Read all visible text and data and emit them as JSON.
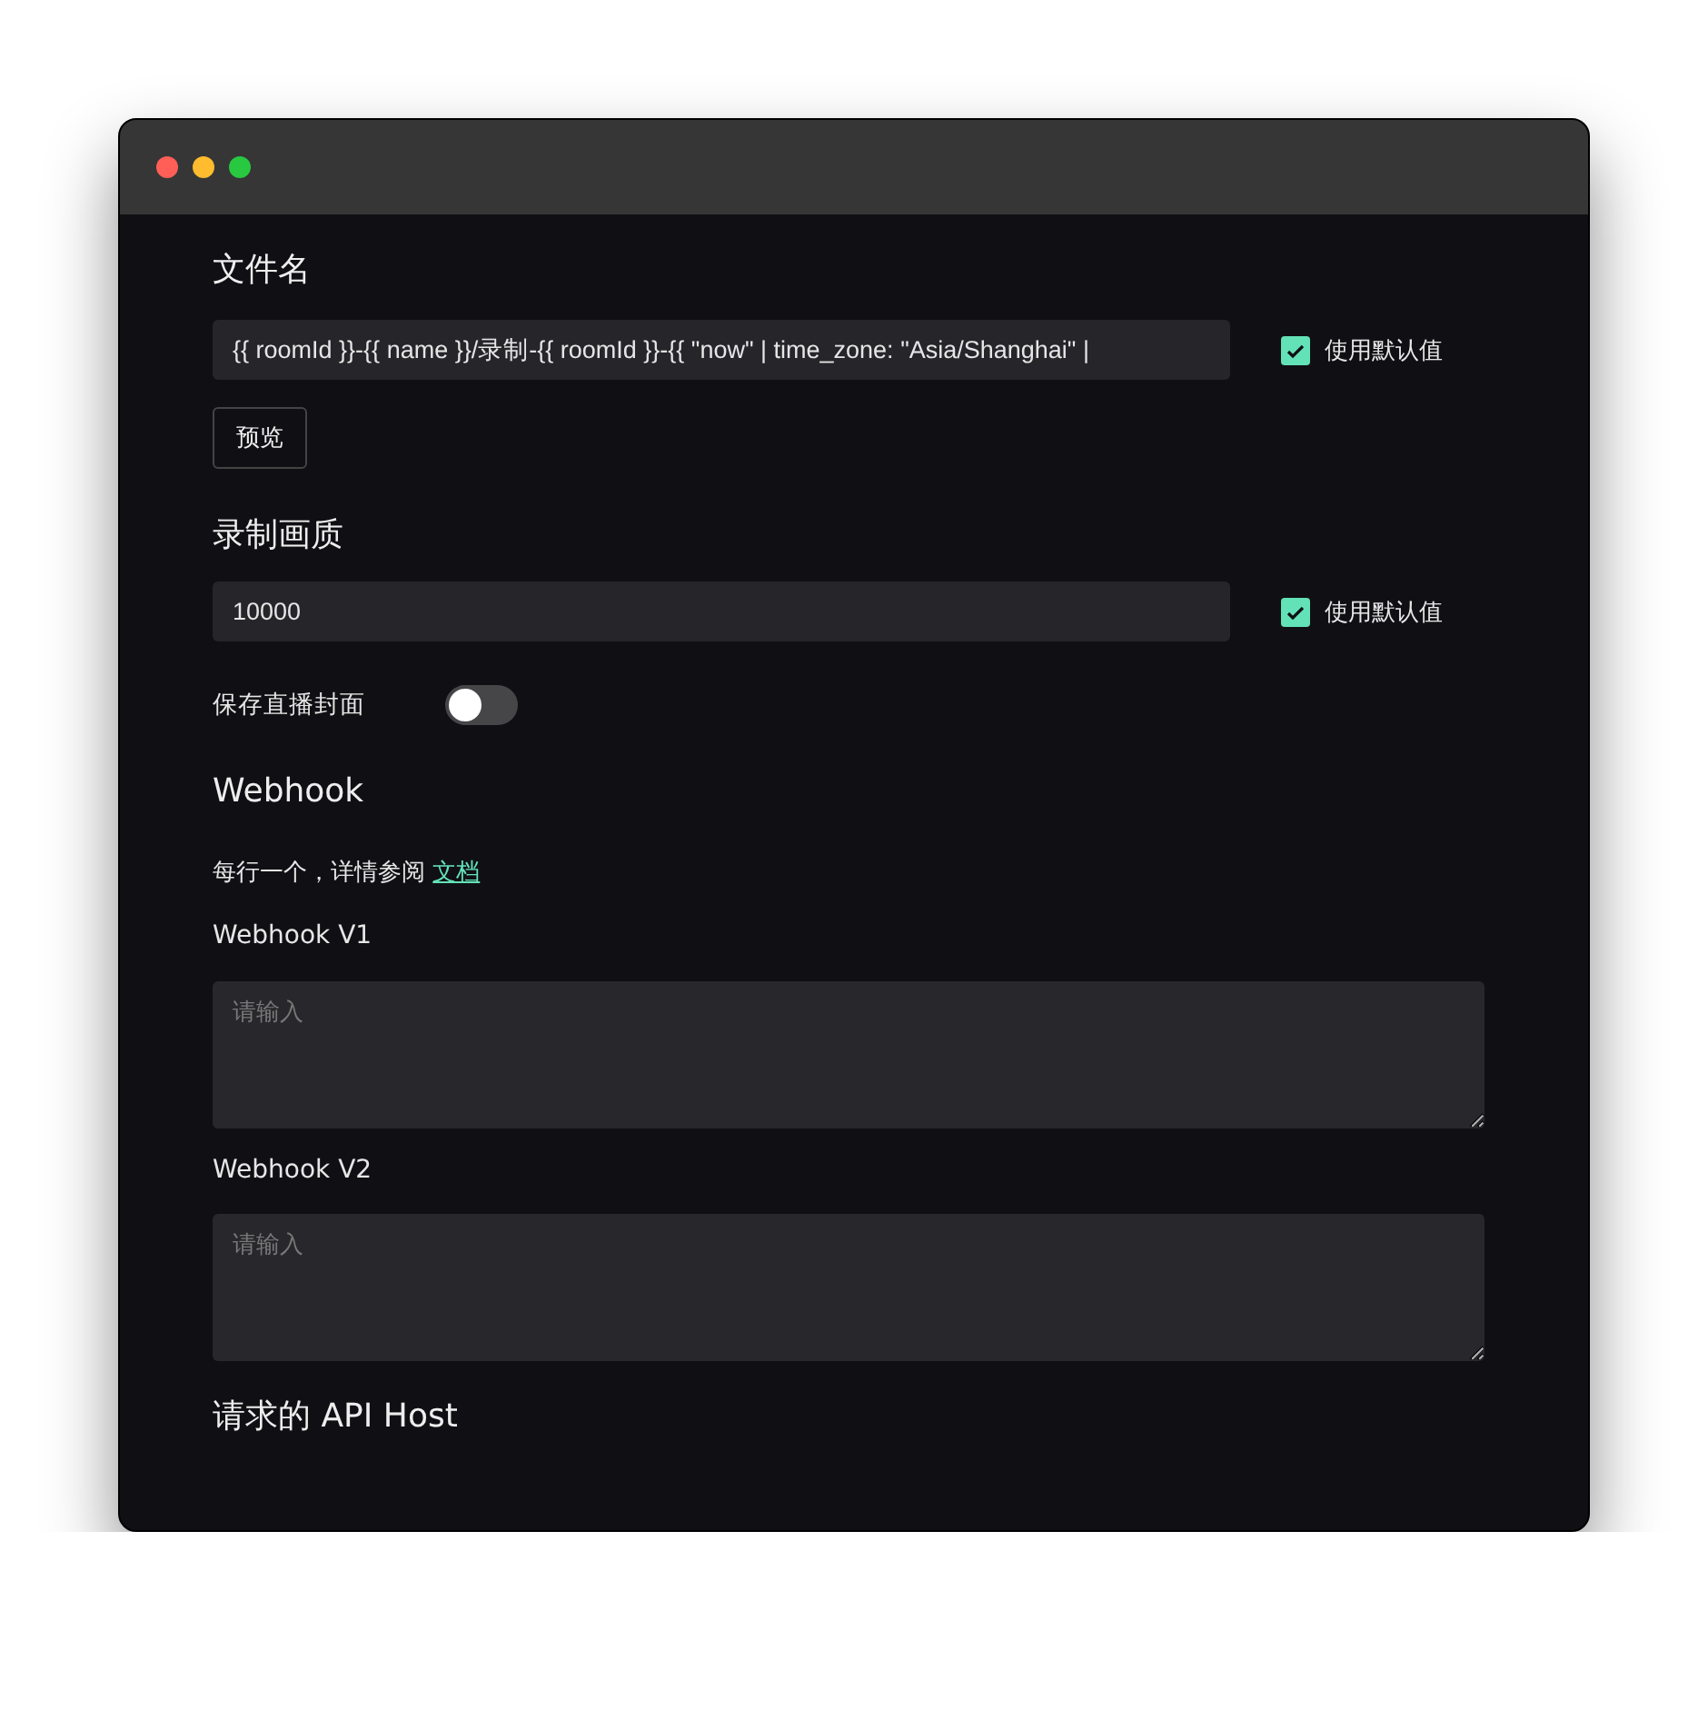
{
  "filename": {
    "heading": "文件名",
    "value": "{{ roomId }}-{{ name }}/录制-{{ roomId }}-{{ \"now\" | time_zone: \"Asia/Shanghai\" |",
    "use_default": {
      "label": "使用默认值",
      "checked": true
    },
    "preview_button": "预览"
  },
  "quality": {
    "heading": "录制画质",
    "value": "10000",
    "use_default": {
      "label": "使用默认值",
      "checked": true
    }
  },
  "save_cover": {
    "label": "保存直播封面",
    "on": false
  },
  "webhook": {
    "heading": "Webhook",
    "description": "每行一个，详情参阅 ",
    "doc_link": "文档",
    "fields": [
      {
        "label": "Webhook V1",
        "placeholder": "请输入"
      },
      {
        "label": "Webhook V2",
        "placeholder": "请输入"
      }
    ]
  },
  "api_host": {
    "heading": "请求的 API Host"
  }
}
